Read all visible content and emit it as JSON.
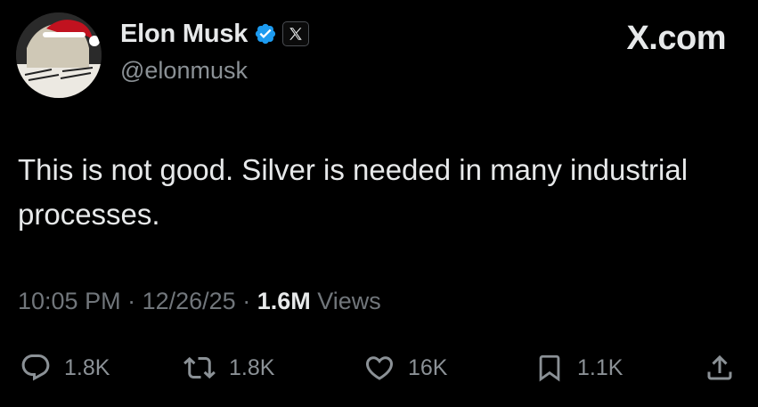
{
  "author": {
    "display_name": "Elon Musk",
    "handle": "@elonmusk",
    "verified_icon": "verified-badge-icon",
    "affiliation_icon": "x-logo-icon"
  },
  "brand": {
    "label": "X.com"
  },
  "tweet": {
    "text": "This is not good. Silver is needed in many industrial processes."
  },
  "meta": {
    "time": "10:05 PM",
    "sep1": " · ",
    "date": "12/26/25",
    "sep2": " · ",
    "views_count": "1.6M",
    "views_label": " Views"
  },
  "actions": {
    "replies": "1.8K",
    "reposts": "1.8K",
    "likes": "16K",
    "bookmarks": "1.1K"
  },
  "colors": {
    "background": "#000000",
    "text": "#e7e9ea",
    "muted": "#71767b",
    "verified": "#1d9bf0"
  }
}
